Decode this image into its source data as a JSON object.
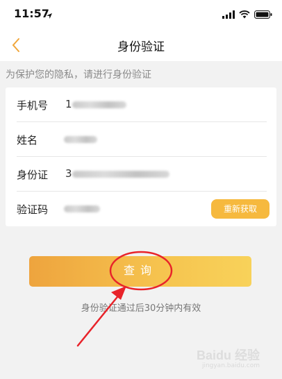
{
  "status_bar": {
    "time": "11:57",
    "icons": [
      "location-arrow-icon",
      "signal-icon",
      "wifi-icon",
      "battery-icon"
    ]
  },
  "nav": {
    "title": "身份验证",
    "back_icon": "chevron-left-icon"
  },
  "hint": "为保护您的隐私，请进行身份验证",
  "form": {
    "rows": [
      {
        "label": "手机号",
        "value": "1"
      },
      {
        "label": "姓名",
        "value": ""
      },
      {
        "label": "身份证",
        "value": "3"
      },
      {
        "label": "验证码",
        "value": ""
      }
    ],
    "resend_label": "重新获取"
  },
  "query_button": {
    "label": "查询"
  },
  "footnote": "身份验证通过后30分钟内有效",
  "watermark": {
    "text": "Baidu 经验",
    "sub": "jingyan.baidu.com"
  },
  "colors": {
    "accent": "#f6b93e",
    "annotation_red": "#e8232a",
    "background": "#f2f2f2"
  }
}
